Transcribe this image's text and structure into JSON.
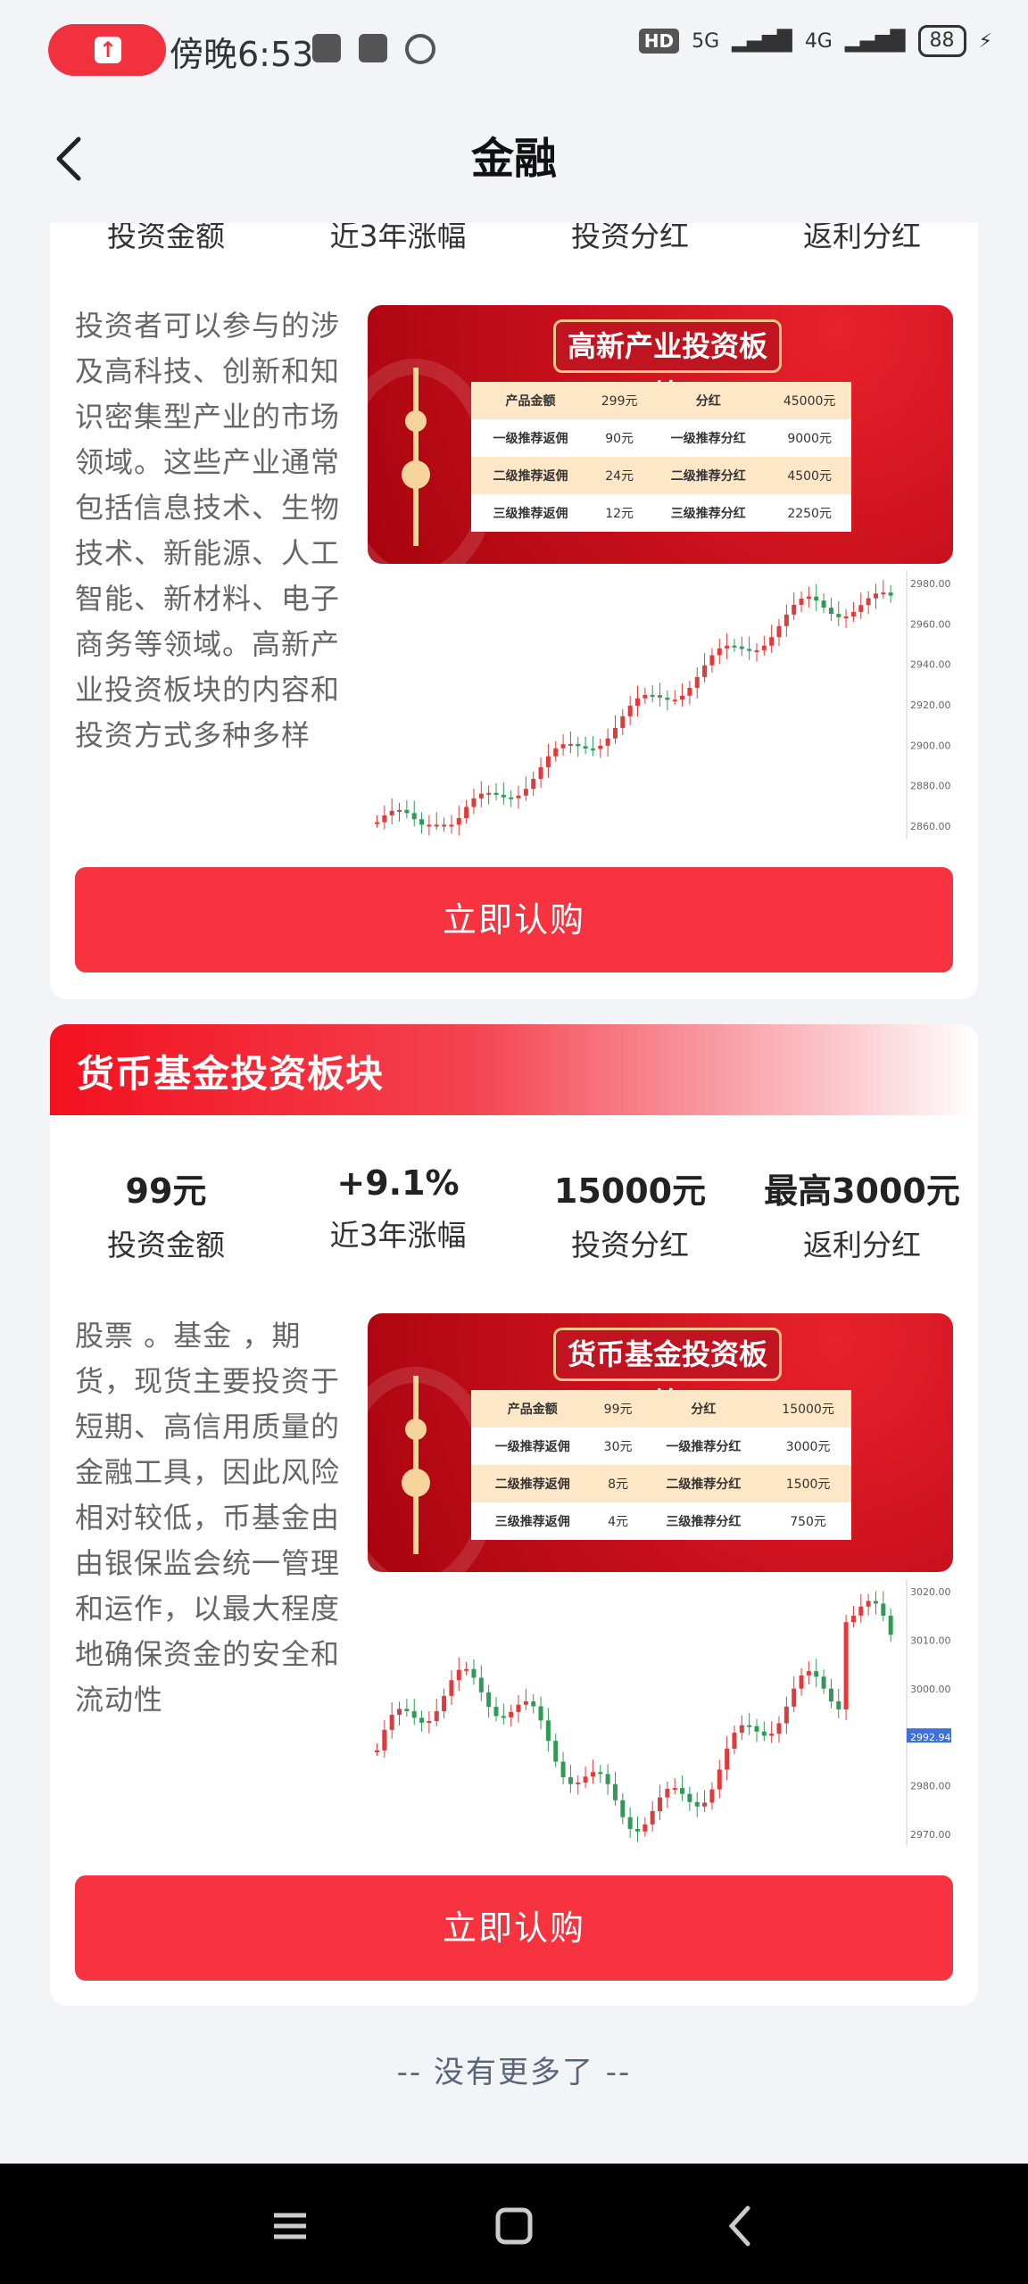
{
  "status_bar": {
    "time": "傍晚6:53",
    "hd": "HD",
    "net1": "5G",
    "net2": "4G",
    "battery": "88"
  },
  "header": {
    "title": "金融"
  },
  "card1": {
    "stats_labels": [
      "投资金额",
      "近3年涨幅",
      "投资分红",
      "返利分红"
    ],
    "description": "投资者可以参与的涉及高科技、创新和知识密集型产业的市场领域。这些产业通常包括信息技术、生物技术、新能源、人工智能、新材料、电子商务等领域。高新产业投资板块的内容和投资方式多种多样",
    "banner": {
      "title": "高新产业投资板块",
      "rows": [
        [
          "产品金额",
          "299元",
          "分红",
          "45000元"
        ],
        [
          "一级推荐返佣",
          "90元",
          "一级推荐分红",
          "9000元"
        ],
        [
          "二级推荐返佣",
          "24元",
          "二级推荐分红",
          "4500元"
        ],
        [
          "三级推荐返佣",
          "12元",
          "三级推荐分红",
          "2250元"
        ]
      ]
    },
    "chart_ticks": [
      "2980.00",
      "2960.00",
      "2940.00",
      "2920.00",
      "2900.00",
      "2880.00",
      "2860.00"
    ],
    "buy_label": "立即认购"
  },
  "card2": {
    "section_title": "货币基金投资板块",
    "stats": [
      {
        "value": "99元",
        "label": "投资金额"
      },
      {
        "value": "+9.1%",
        "label": "近3年涨幅"
      },
      {
        "value": "15000元",
        "label": "投资分红"
      },
      {
        "value": "最高3000元",
        "label": "返利分红"
      }
    ],
    "description": "股票 。基金 ，期货，现货主要投资于短期、高信用质量的金融工具，因此风险相对较低，币基金由由银保监会统一管理和运作，以最大程度地确保资金的安全和流动性",
    "banner": {
      "title": "货币基金投资板块",
      "rows": [
        [
          "产品金额",
          "99元",
          "分红",
          "15000元"
        ],
        [
          "一级推荐返佣",
          "30元",
          "一级推荐分红",
          "3000元"
        ],
        [
          "二级推荐返佣",
          "8元",
          "二级推荐分红",
          "1500元"
        ],
        [
          "三级推荐返佣",
          "4元",
          "三级推荐分红",
          "750元"
        ]
      ]
    },
    "chart_ticks": [
      "3020.00",
      "3010.00",
      "3000.00",
      "2992.94",
      "2980.00",
      "2970.00"
    ],
    "buy_label": "立即认购"
  },
  "footer": {
    "no_more": "-- 没有更多了 --"
  },
  "colors": {
    "accent": "#f7333f",
    "header_red": "#f3111f"
  },
  "icons": [
    "back-icon",
    "menu-icon",
    "home-icon",
    "nav-back-icon"
  ]
}
